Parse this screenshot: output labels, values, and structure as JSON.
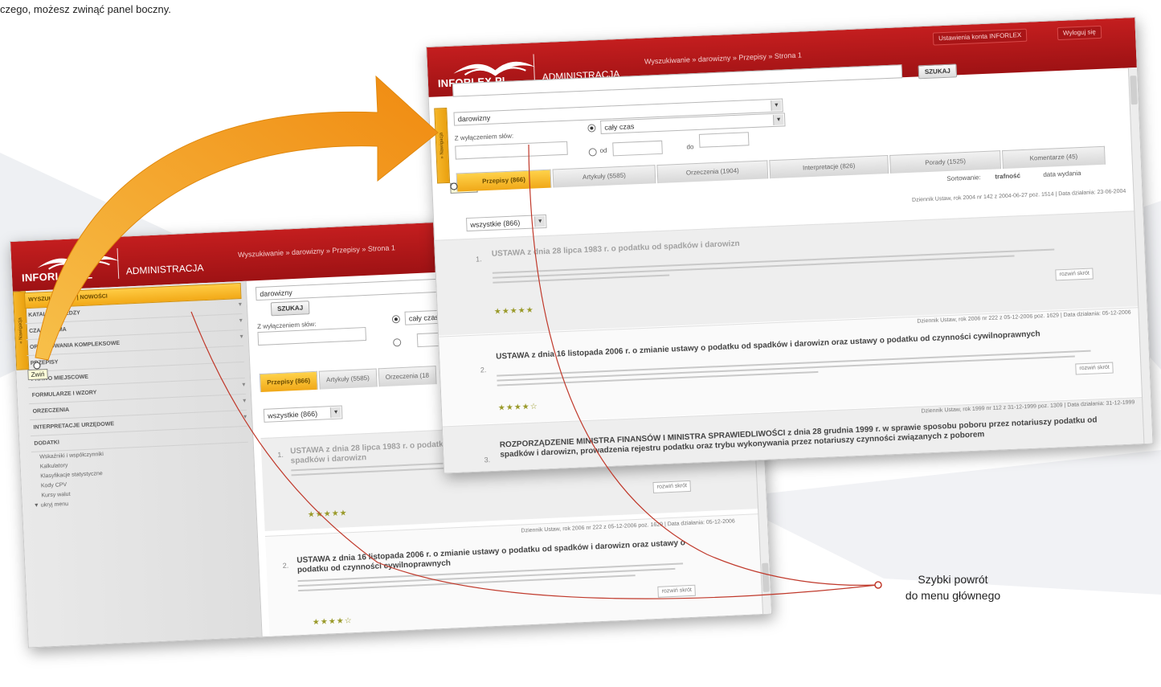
{
  "intro_text": "czego, możesz zwinąć panel boczny.",
  "annotation": {
    "line1": "Szybki powrót",
    "line2": "do menu głównego"
  },
  "colors": {
    "brand_red": "#b3191b",
    "accent_orange": "#f2a917",
    "arrow_orange": "#f5a623",
    "callout_red": "#c0392b"
  },
  "back_screen": {
    "logo": "INFORLEX.PL",
    "admin": "ADMINISTRACJA",
    "breadcrumb": "Wyszukiwanie » darowizny » Przepisy » Strona 1",
    "sidebar_items": [
      "Wyszukiwarka | Nowości",
      "Katalogi wiedzy",
      "Czasopisma",
      "Opracowania kompleksowe",
      "Przepisy",
      "Prawo miejscowe",
      "Formularze i wzory",
      "Orzeczenia",
      "Interpretacje urzędowe",
      "Dodatki"
    ],
    "sidebar_subitems": [
      "Wskaźniki i współczynniki",
      "Kalkulatory",
      "Klasyfikacje statystyczne",
      "Kody CPV",
      "Kursy walut",
      "▼ ukryj menu"
    ],
    "tooltip": "Zwiń",
    "search_value": "darowizny",
    "search_button": "SZUKAJ",
    "exclude_label": "Z wyłączeniem słów:",
    "radio_label": "cały czas",
    "tabs": [
      "Przepisy (866)",
      "Artykuły (5585)",
      "Orzeczenia (18"
    ],
    "filter_value": "wszystkie (866)",
    "results": [
      {
        "num": "1.",
        "title": "USTAWA z dnia 28 lipca 1983 r. o podatku od spadków i darowizn",
        "meta": "Dziennik Ustaw, rok 2004 nr 142 z 2004-06-27",
        "more": "rozwiń skrót"
      },
      {
        "num": "2.",
        "title": "USTAWA z dnia 16 listopada 2006 r. o zmianie ustawy o podatku od spadków i darowizn oraz ustawy o podatku od czynności cywilnoprawnych",
        "meta": "Dziennik Ustaw, rok 2006 nr 222 z 05-12-2006 poz. 1629 | Data działania: 05-12-2006",
        "more": "rozwiń skrót"
      }
    ]
  },
  "front_screen": {
    "logo": "INFORLEX.PL",
    "admin": "ADMINISTRACJA",
    "breadcrumb": "Wyszukiwanie » darowizny » Przepisy » Strona 1",
    "header_buttons": [
      "Ustawienia konta INFORLEX",
      "Wyloguj się"
    ],
    "tooltip": "Rozwiń",
    "sidebar_collapsed_label": "» Nawigacja",
    "search_value": "darowizny",
    "search_button": "SZUKAJ",
    "exclude_label": "Z wyłączeniem słów:",
    "radio_label": "cały czas",
    "from_label": "od",
    "to_label": "do",
    "tabs": [
      "Przepisy (866)",
      "Artykuły (5585)",
      "Orzeczenia (1904)",
      "Interpretacje (826)",
      "Porady (1525)",
      "Komentarze (45)"
    ],
    "sort_label": "Sortowanie:",
    "sort_value": "trafność",
    "sort_extra": "data wydania",
    "filter_value": "wszystkie (866)",
    "results": [
      {
        "num": "1.",
        "title": "USTAWA z dnia 28 lipca 1983 r. o podatku od spadków i darowizn",
        "meta": "Dziennik Ustaw, rok 2004 nr 142 z 2004-06-27 poz. 1514 | Data działania: 23-06-2004",
        "more": "rozwiń skrót"
      },
      {
        "num": "2.",
        "title": "USTAWA z dnia 16 listopada 2006 r. o zmianie ustawy o podatku od spadków i darowizn oraz ustawy o podatku od czynności cywilnoprawnych",
        "meta": "Dziennik Ustaw, rok 2006 nr 222 z 05-12-2006 poz. 1629 | Data działania: 05-12-2006",
        "more": "rozwiń skrót"
      },
      {
        "num": "3.",
        "title": "ROZPORZĄDZENIE MINISTRA FINANSÓW I MINISTRA SPRAWIEDLIWOŚCI z dnia 28 grudnia 1999 r. w sprawie sposobu poboru przez notariuszy podatku od spadków i darowizn, prowadzenia rejestru podatku oraz trybu wykonywania przez notariuszy czynności związanych z poborem",
        "meta": "Dziennik Ustaw, rok 1999 nr 112 z 31-12-1999 poz. 1309 | Data działania: 31-12-1999",
        "more": ""
      }
    ]
  }
}
